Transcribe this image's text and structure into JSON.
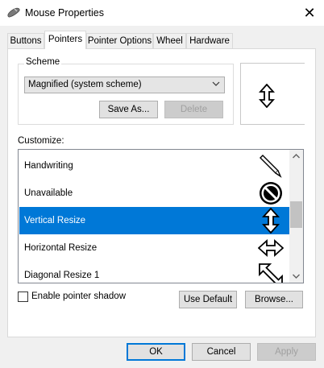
{
  "window": {
    "title": "Mouse Properties",
    "close_glyph": "✕",
    "icon": "mouse-icon"
  },
  "tabs": [
    {
      "label": "Buttons",
      "active": false
    },
    {
      "label": "Pointers",
      "active": true
    },
    {
      "label": "Pointer Options",
      "active": false
    },
    {
      "label": "Wheel",
      "active": false
    },
    {
      "label": "Hardware",
      "active": false
    }
  ],
  "scheme": {
    "label": "Scheme",
    "selected": "Magnified (system scheme)",
    "save_as_label": "Save As...",
    "delete_label": "Delete"
  },
  "customize": {
    "label": "Customize:",
    "items": [
      {
        "label": "Handwriting",
        "icon": "pen-cursor-icon",
        "selected": false
      },
      {
        "label": "Unavailable",
        "icon": "unavailable-cursor-icon",
        "selected": false
      },
      {
        "label": "Vertical Resize",
        "icon": "vertical-resize-cursor-icon",
        "selected": true
      },
      {
        "label": "Horizontal Resize",
        "icon": "horizontal-resize-cursor-icon",
        "selected": false
      },
      {
        "label": "Diagonal Resize 1",
        "icon": "diagonal-resize-cursor-icon",
        "selected": false
      }
    ]
  },
  "options": {
    "pointer_shadow_label": "Enable pointer shadow",
    "pointer_shadow_checked": false
  },
  "buttons": {
    "use_default_label": "Use Default",
    "browse_label": "Browse...",
    "ok_label": "OK",
    "cancel_label": "Cancel",
    "apply_label": "Apply"
  },
  "colors": {
    "selection": "#0078d7",
    "accent": "#0078d7"
  }
}
